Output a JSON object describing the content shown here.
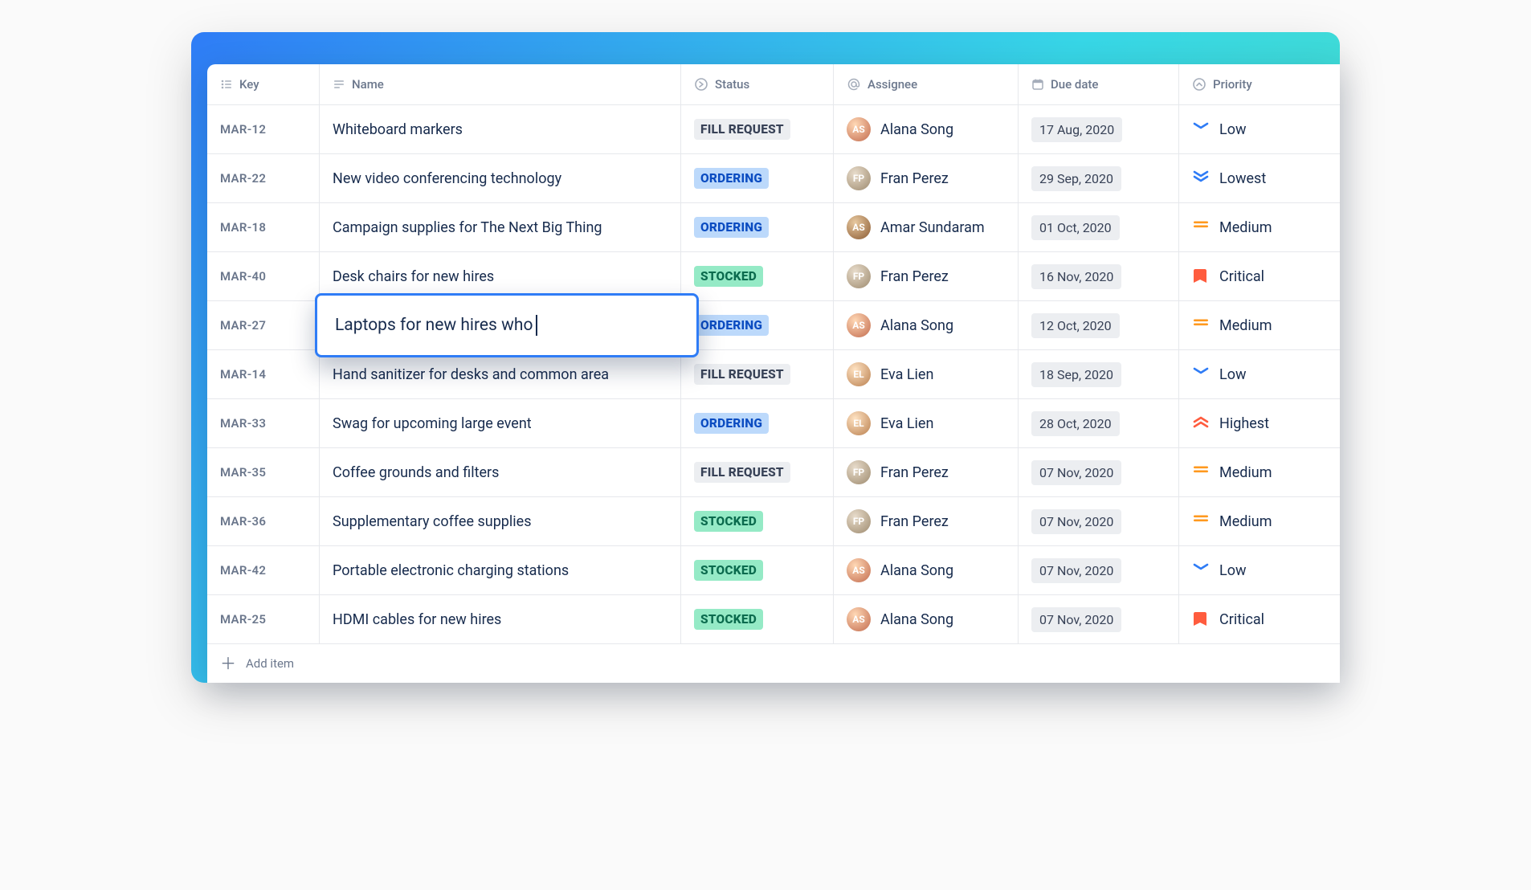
{
  "columns": {
    "key": "Key",
    "name": "Name",
    "status": "Status",
    "assignee": "Assignee",
    "due_date": "Due date",
    "priority": "Priority"
  },
  "statuses": {
    "FILL_REQUEST": "FILL REQUEST",
    "ORDERING": "ORDERING",
    "STOCKED": "STOCKED"
  },
  "priorities": {
    "low": "Low",
    "lowest": "Lowest",
    "medium": "Medium",
    "critical": "Critical",
    "highest": "Highest"
  },
  "assignees": {
    "alana": {
      "name": "Alana Song",
      "initials": "AS",
      "avatar_class": "av-as"
    },
    "fran": {
      "name": "Fran Perez",
      "initials": "FP",
      "avatar_class": "av-fp"
    },
    "amar": {
      "name": "Amar Sundaram",
      "initials": "AS",
      "avatar_class": "av-am"
    },
    "eva": {
      "name": "Eva Lien",
      "initials": "EL",
      "avatar_class": "av-el"
    }
  },
  "editing_row_index": 4,
  "editing_value": "Laptops for new hires who",
  "rows": [
    {
      "key": "MAR-12",
      "name": "Whiteboard markers",
      "status": "FILL_REQUEST",
      "assignee": "alana",
      "due": "17 Aug, 2020",
      "priority": "low"
    },
    {
      "key": "MAR-22",
      "name": "New video conferencing technology",
      "status": "ORDERING",
      "assignee": "fran",
      "due": "29 Sep, 2020",
      "priority": "lowest"
    },
    {
      "key": "MAR-18",
      "name": "Campaign supplies for The Next Big Thing",
      "status": "ORDERING",
      "assignee": "amar",
      "due": "01 Oct, 2020",
      "priority": "medium"
    },
    {
      "key": "MAR-40",
      "name": "Desk chairs for new hires",
      "status": "STOCKED",
      "assignee": "fran",
      "due": "16 Nov, 2020",
      "priority": "critical"
    },
    {
      "key": "MAR-27",
      "name": "Laptops for new hires who",
      "status": "ORDERING",
      "assignee": "alana",
      "due": "12 Oct, 2020",
      "priority": "medium"
    },
    {
      "key": "MAR-14",
      "name": "Hand sanitizer for desks and common area",
      "status": "FILL_REQUEST",
      "assignee": "eva",
      "due": "18 Sep, 2020",
      "priority": "low"
    },
    {
      "key": "MAR-33",
      "name": "Swag for upcoming large event",
      "status": "ORDERING",
      "assignee": "eva",
      "due": "28 Oct, 2020",
      "priority": "highest"
    },
    {
      "key": "MAR-35",
      "name": "Coffee grounds and filters",
      "status": "FILL_REQUEST",
      "assignee": "fran",
      "due": "07 Nov, 2020",
      "priority": "medium"
    },
    {
      "key": "MAR-36",
      "name": "Supplementary coffee supplies",
      "status": "STOCKED",
      "assignee": "fran",
      "due": "07 Nov, 2020",
      "priority": "medium"
    },
    {
      "key": "MAR-42",
      "name": "Portable electronic charging stations",
      "status": "STOCKED",
      "assignee": "alana",
      "due": "07 Nov, 2020",
      "priority": "low"
    },
    {
      "key": "MAR-25",
      "name": "HDMI cables for new hires",
      "status": "STOCKED",
      "assignee": "alana",
      "due": "07 Nov, 2020",
      "priority": "critical"
    }
  ],
  "add_item_label": "Add item"
}
